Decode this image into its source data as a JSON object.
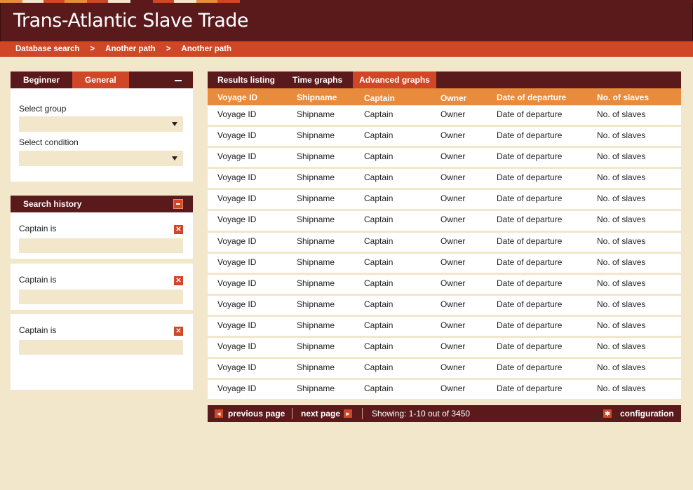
{
  "app": {
    "title": "Trans-Atlantic Slave Trade"
  },
  "colors": {
    "dark_red": "#5a1a1c",
    "orange_red": "#cf4726",
    "orange": "#e98b3c",
    "beige": "#f2e6cb"
  },
  "breadcrumb": {
    "items": [
      "Database search",
      "Another path",
      "Another path"
    ],
    "separator": ">"
  },
  "search_panel": {
    "tabs": [
      "Beginner",
      "General"
    ],
    "active_tab": "General",
    "select_group_label": "Select group",
    "select_condition_label": "Select condition",
    "select_group_value": "",
    "select_condition_value": ""
  },
  "history": {
    "title": "Search history",
    "items": [
      {
        "label": "Captain is",
        "value": ""
      },
      {
        "label": "Captain is",
        "value": ""
      },
      {
        "label": "Captain is",
        "value": ""
      }
    ]
  },
  "results": {
    "tabs": [
      "Results listing",
      "Time graphs",
      "Advanced graphs"
    ],
    "active_tab": "Advanced graphs",
    "columns": [
      "Voyage ID",
      "Shipname",
      "Captain",
      "Owner",
      "Date of departure",
      "No. of slaves"
    ],
    "rows": [
      [
        "Voyage ID",
        "Shipname",
        "Captain",
        "Owner",
        "Date of departure",
        "No. of slaves"
      ],
      [
        "Voyage ID",
        "Shipname",
        "Captain",
        "Owner",
        "Date of departure",
        "No. of slaves"
      ],
      [
        "Voyage ID",
        "Shipname",
        "Captain",
        "Owner",
        "Date of departure",
        "No. of slaves"
      ],
      [
        "Voyage ID",
        "Shipname",
        "Captain",
        "Owner",
        "Date of departure",
        "No. of slaves"
      ],
      [
        "Voyage ID",
        "Shipname",
        "Captain",
        "Owner",
        "Date of departure",
        "No. of slaves"
      ],
      [
        "Voyage ID",
        "Shipname",
        "Captain",
        "Owner",
        "Date of departure",
        "No. of slaves"
      ],
      [
        "Voyage ID",
        "Shipname",
        "Captain",
        "Owner",
        "Date of departure",
        "No. of slaves"
      ],
      [
        "Voyage ID",
        "Shipname",
        "Captain",
        "Owner",
        "Date of departure",
        "No. of slaves"
      ],
      [
        "Voyage ID",
        "Shipname",
        "Captain",
        "Owner",
        "Date of departure",
        "No. of slaves"
      ],
      [
        "Voyage ID",
        "Shipname",
        "Captain",
        "Owner",
        "Date of departure",
        "No. of slaves"
      ],
      [
        "Voyage ID",
        "Shipname",
        "Captain",
        "Owner",
        "Date of departure",
        "No. of slaves"
      ],
      [
        "Voyage ID",
        "Shipname",
        "Captain",
        "Owner",
        "Date of departure",
        "No. of slaves"
      ],
      [
        "Voyage ID",
        "Shipname",
        "Captain",
        "Owner",
        "Date of departure",
        "No. of slaves"
      ],
      [
        "Voyage ID",
        "Shipname",
        "Captain",
        "Owner",
        "Date of departure",
        "No. of slaves"
      ]
    ]
  },
  "pagination": {
    "previous_label": "previous page",
    "next_label": "next page",
    "showing_text": "Showing: 1-10 out of 3450",
    "configuration_label": "configuration"
  },
  "icons": {
    "collapse": "minus-icon",
    "remove": "close-icon",
    "prev": "arrow-left-icon",
    "next": "arrow-right-icon",
    "config": "gear-icon"
  }
}
